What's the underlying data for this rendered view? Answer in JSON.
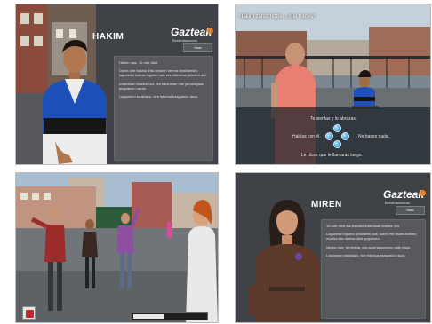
{
  "panels": {
    "hakim": {
      "name": "HAKIM",
      "logo": "Gazteak",
      "logo_sub": "Berdintasunean",
      "button": "Hasi",
      "paragraphs": [
        "Hakim naiz, 16 urte ditut.",
        "Duela urte batzuk iritsi nintzen herrira familiarekin; lagunekin kalean egoten naiz eta futbolean jolasten dut.",
        "Institutuan ikasten dut, eta batzuetan nire jatorriagatik begiratzen naute.",
        "Laguntzen badidazu, nire istorioa ezagutuko duzu."
      ]
    },
    "dialogue": {
      "question": "Hakim zatoz hitzik, ¿qué haces?",
      "options": {
        "top": "Te sientas y lo abrazas.",
        "left": "Hablas con él.",
        "right": "No haces nada.",
        "bottom": "Le dices que le llamarás luego."
      }
    },
    "game": {
      "progress": 0.42
    },
    "miren": {
      "name": "MIREN",
      "logo": "Gazteak",
      "logo_sub": "Berdintasunean",
      "button": "Hasi",
      "paragraphs": [
        "15 urte ditut eta Bilboko institutuan ikasten dut.",
        "Lagunekin egotea gustatzen zait, batez ere asteburuetan; musika eta dantza ditut gogokoen.",
        "Neska naiz, feminista, eta zuzentasunaren alde nago.",
        "Laguntzen badidazu, nire istorioa ezagutuko duzu."
      ]
    }
  },
  "colors": {
    "accent_orange": "#e8822a",
    "orb_blue": "#3a9ad8",
    "hud_red": "#c0282a"
  },
  "icons": {
    "logo_dot": "circle-dot-icon",
    "hud": "backpack-icon",
    "orb": "orb-icon"
  }
}
